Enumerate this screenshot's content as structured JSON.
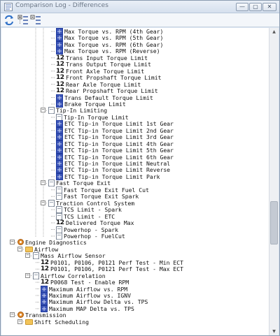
{
  "window": {
    "title": "Comparison Log - Differences",
    "minimize_glyph": "—",
    "maximize_glyph": "▢",
    "close_glyph": "✕"
  },
  "toolbar": {
    "buttons": [
      {
        "name": "refresh-icon"
      },
      {
        "name": "expand-all-icon"
      },
      {
        "name": "collapse-all-icon"
      }
    ]
  },
  "tree": {
    "rows": [
      {
        "text": "Max Torque vs. RPM (4th Gear)",
        "icon": "grid"
      },
      {
        "text": "Max Torque vs. RPM (5th Gear)",
        "icon": "grid"
      },
      {
        "text": "Max Torque vs. RPM (6th Gear)",
        "icon": "grid"
      },
      {
        "text": "Max Torque vs. RPM (Reverse)",
        "icon": "grid"
      },
      {
        "text": "Trans Input Torque Limit",
        "icon": "12"
      },
      {
        "text": "Trans Output Torque Limit",
        "icon": "12"
      },
      {
        "text": "Front Axle Torque Limit",
        "icon": "12"
      },
      {
        "text": "Front Propshaft Torque Limit",
        "icon": "12"
      },
      {
        "text": "Rear Axle Torque Limit",
        "icon": "12"
      },
      {
        "text": "Rear Propshaft Torque Limit",
        "icon": "12"
      },
      {
        "text": "Trans Default Torque Limit",
        "icon": "grid"
      },
      {
        "text": "Brake Torque Limit",
        "icon": "grid"
      },
      {
        "text": "Tip-In Limiting",
        "icon": "doc",
        "expander": "−"
      },
      {
        "text": "Tip-In Torque Limit",
        "icon": "doc"
      },
      {
        "text": "ETC Tip-in Torque Limit 1st Gear",
        "icon": "grid"
      },
      {
        "text": "ETC Tip-in Torque Limit 2nd Gear",
        "icon": "grid"
      },
      {
        "text": "ETC Tip-in Torque Limit 3rd Gear",
        "icon": "grid"
      },
      {
        "text": "ETC Tip-in Torque Limit 4th Gear",
        "icon": "grid"
      },
      {
        "text": "ETC Tip-in Torque Limit 5th Gear",
        "icon": "grid"
      },
      {
        "text": "ETC Tip-in Torque Limit 6th Gear",
        "icon": "grid"
      },
      {
        "text": "ETC Tip-in Torque Limit Neutral",
        "icon": "grid"
      },
      {
        "text": "ETC Tip-in Torque Limit Reverse",
        "icon": "grid"
      },
      {
        "text": "ETC Tip-in Torque Limit Park",
        "icon": "grid"
      },
      {
        "text": "Fast Torque Exit",
        "icon": "doc",
        "expander": "−"
      },
      {
        "text": "Fast Torque Exit Fuel Cut",
        "icon": "doc"
      },
      {
        "text": "Fast Torque Exit Spark",
        "icon": "doc"
      },
      {
        "text": "Traction Control System",
        "icon": "doc",
        "expander": "−"
      },
      {
        "text": "TCS Limit - Spark",
        "icon": "doc"
      },
      {
        "text": "TCS Limit - ETC",
        "icon": "doc"
      },
      {
        "text": "Delivered Torque Max",
        "icon": "12"
      },
      {
        "text": "Powerhop - Spark",
        "icon": "doc"
      },
      {
        "text": "Powerhop - FuelCut",
        "icon": "doc"
      },
      {
        "text": "Engine Diagnostics",
        "icon": "gear",
        "expander": "−"
      },
      {
        "text": "Airflow",
        "icon": "folder",
        "expander": "−"
      },
      {
        "text": "Mass Airflow Sensor",
        "icon": "doc",
        "expander": "−"
      },
      {
        "text": "P0101, P0106, P0121 Perf Test - Min ECT",
        "icon": "12"
      },
      {
        "text": "P0101, P0106, P0121 Perf Test - Max ECT",
        "icon": "12"
      },
      {
        "text": "Airflow Correlation",
        "icon": "doc",
        "expander": "−"
      },
      {
        "text": "P0068 Test - Enable RPM",
        "icon": "12"
      },
      {
        "text": "Maximum Airflow vs. RPM",
        "icon": "grid"
      },
      {
        "text": "Maximum Airflow vs. IGNV",
        "icon": "grid"
      },
      {
        "text": "Maximum Airflow Delta vs. TPS",
        "icon": "grid"
      },
      {
        "text": "Maximum MAP Delta vs. TPS",
        "icon": "grid"
      },
      {
        "text": "Transmission",
        "icon": "gear",
        "expander": "−"
      },
      {
        "text": "Shift Scheduling",
        "icon": "folder",
        "expander": "−"
      }
    ]
  },
  "scrollbar": {
    "up_glyph": "▲",
    "down_glyph": "▼"
  }
}
